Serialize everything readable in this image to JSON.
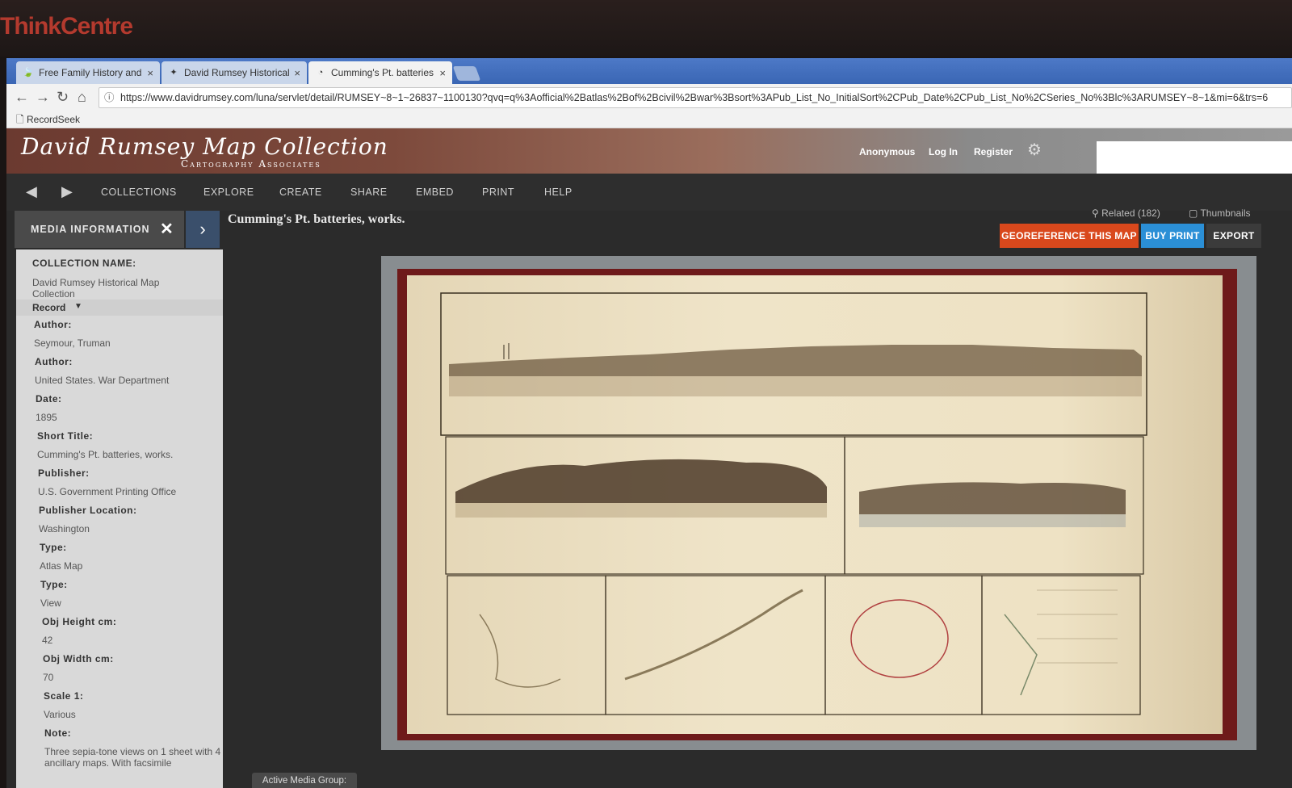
{
  "monitor": {
    "brand": "ThinkCentre"
  },
  "browser": {
    "tabs": [
      {
        "label": "Free Family History and",
        "icon": "leaf-icon",
        "close": "×"
      },
      {
        "label": "David Rumsey Historical",
        "icon": "compass-icon",
        "close": "×"
      },
      {
        "label": "Cumming's Pt. batteries",
        "icon": "loading-icon",
        "close": "×"
      }
    ],
    "url": "https://www.davidrumsey.com/luna/servlet/detail/RUMSEY~8~1~26837~1100130?qvq=q%3Aofficial%2Batlas%2Bof%2Bcivil%2Bwar%3Bsort%3APub_List_No_InitialSort%2CPub_Date%2CPub_List_No%2CSeries_No%3Blc%3ARUMSEY~8~1&mi=6&trs=6",
    "bookmark": "RecordSeek"
  },
  "site": {
    "title": "David Rumsey Map Collection",
    "subtitle": "Cartography Associates",
    "links": {
      "anonymous": "Anonymous",
      "login": "Log In",
      "register": "Register"
    }
  },
  "nav": {
    "items": [
      "COLLECTIONS",
      "EXPLORE",
      "CREATE",
      "SHARE",
      "EMBED",
      "PRINT",
      "HELP"
    ]
  },
  "panel": {
    "title": "MEDIA INFORMATION",
    "close": "✕",
    "toggle": "›",
    "collection_label": "COLLECTION NAME:",
    "collection_value": "David Rumsey Historical Map Collection",
    "record_label": "Record",
    "fields": [
      {
        "label": "Author:",
        "value": "Seymour, Truman"
      },
      {
        "label": "Author:",
        "value": "United States. War Department"
      },
      {
        "label": "Date:",
        "value": "1895"
      },
      {
        "label": "Short Title:",
        "value": "Cumming's Pt. batteries, works."
      },
      {
        "label": "Publisher:",
        "value": "U.S. Government Printing Office"
      },
      {
        "label": "Publisher Location:",
        "value": "Washington"
      },
      {
        "label": "Type:",
        "value": "Atlas Map"
      },
      {
        "label": "Type:",
        "value": "View"
      },
      {
        "label": "Obj Height cm:",
        "value": "42"
      },
      {
        "label": "Obj Width cm:",
        "value": "70"
      },
      {
        "label": "Scale 1:",
        "value": "Various"
      },
      {
        "label": "Note:",
        "value": "Three sepia-tone views on 1 sheet with 4 ancillary maps. With facsimile"
      }
    ]
  },
  "main": {
    "title": "Cumming's Pt. batteries, works.",
    "related": "Related (182)",
    "thumbnails": "Thumbnails",
    "buttons": {
      "georeference": "GEOREFERENCE THIS MAP",
      "buy": "BUY PRINT",
      "export": "EXPORT"
    },
    "active_group": "Active Media Group:"
  },
  "colors": {
    "georeference": "#d9481c",
    "buy": "#2b8fd6",
    "export": "#3b3b3b",
    "tabbar": "#3a66b4"
  }
}
